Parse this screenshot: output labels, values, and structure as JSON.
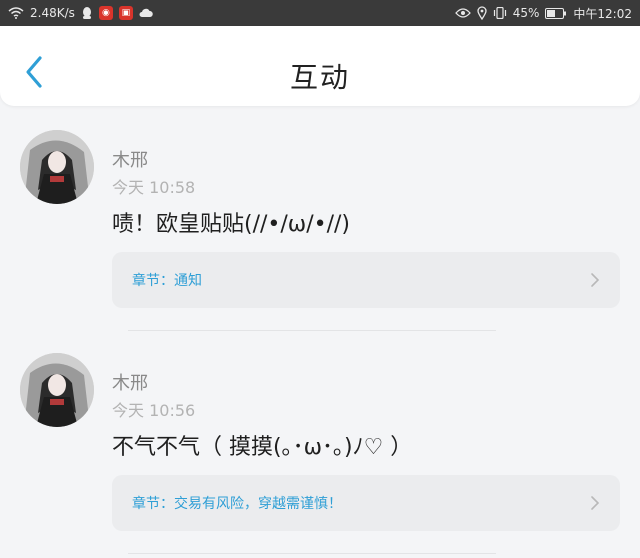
{
  "statusbar": {
    "net_speed": "2.48K/s",
    "battery_percent": "45%",
    "time": "中午12:02"
  },
  "header": {
    "title": "互动",
    "back_icon": "chevron-left-icon"
  },
  "colors": {
    "accent": "#2f9fd6",
    "statusbar_bg": "#3a3a3a",
    "page_bg": "#f4f5f7"
  },
  "feed": {
    "items": [
      {
        "name": "木邢",
        "time": "今天 10:58",
        "message": "啧！欧皇贴贴(//•/ω/•//)",
        "chapter_label": "章节：",
        "chapter_title": "通知"
      },
      {
        "name": "木邢",
        "time": "今天 10:56",
        "message": "不气不气（ 摸摸(｡･ω･｡)ﾉ♡ ）",
        "chapter_label": "章节：",
        "chapter_title": "交易有风险，穿越需谨慎！"
      }
    ]
  }
}
